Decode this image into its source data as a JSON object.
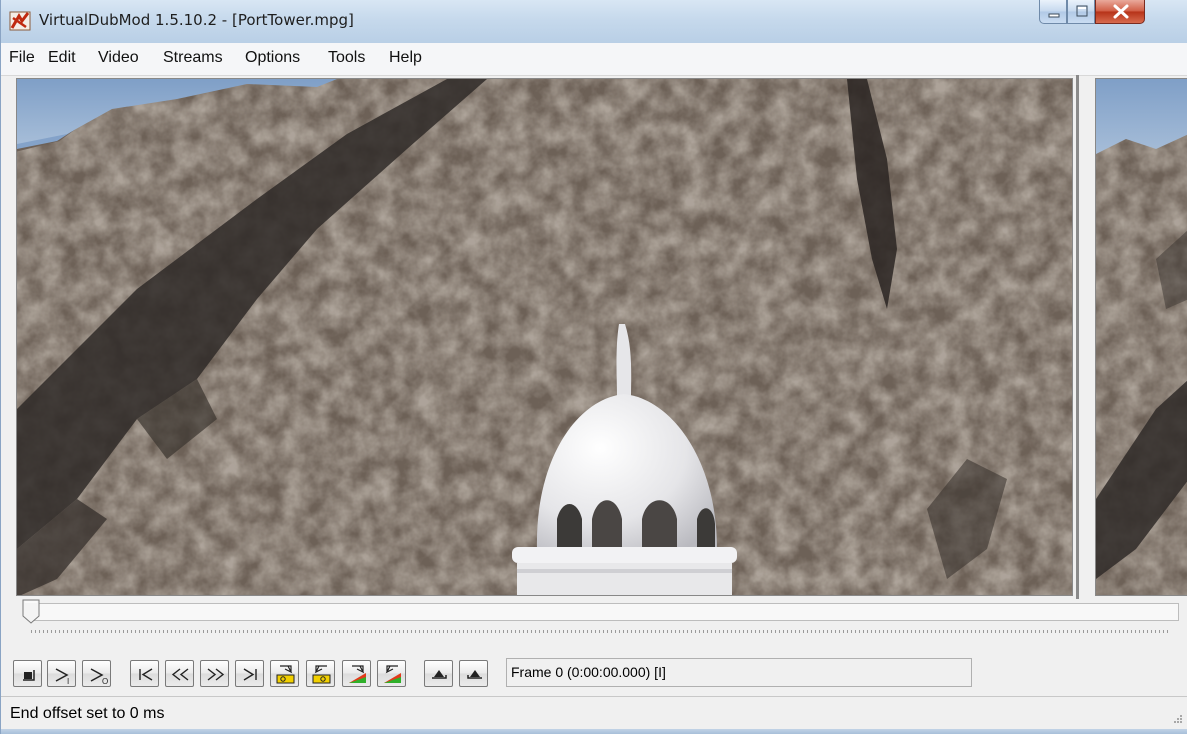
{
  "window": {
    "title": "VirtualDubMod 1.5.10.2 - [PortTower.mpg]",
    "app_icon": "virtualdub-icon",
    "controls": [
      "minimize-icon",
      "maximize-icon",
      "close-icon"
    ]
  },
  "menu": {
    "file": "File",
    "edit": "Edit",
    "video": "Video",
    "streams": "Streams",
    "options": "Options",
    "tools": "Tools",
    "help": "Help"
  },
  "timeline": {
    "position_fraction": 0
  },
  "toolbar": {
    "buttons": [
      "stop-icon",
      "play-input-icon",
      "play-output-icon",
      "go-to-start-icon",
      "previous-frame-icon",
      "next-frame-icon",
      "go-to-end-icon",
      "previous-keyframe-icon",
      "next-keyframe-icon",
      "previous-scene-icon",
      "next-scene-icon",
      "mark-in-icon",
      "mark-out-icon"
    ],
    "frame_label": "Frame 0 (0:00:00.000) [I]"
  },
  "status": {
    "text": "End offset set to 0 ms"
  },
  "colors": {
    "title_bar": "#c6d9ec",
    "close_button": "#c7452a",
    "rock": "#6e6257",
    "sky": "#8ea9c9",
    "dome": "#e8e8ea"
  }
}
